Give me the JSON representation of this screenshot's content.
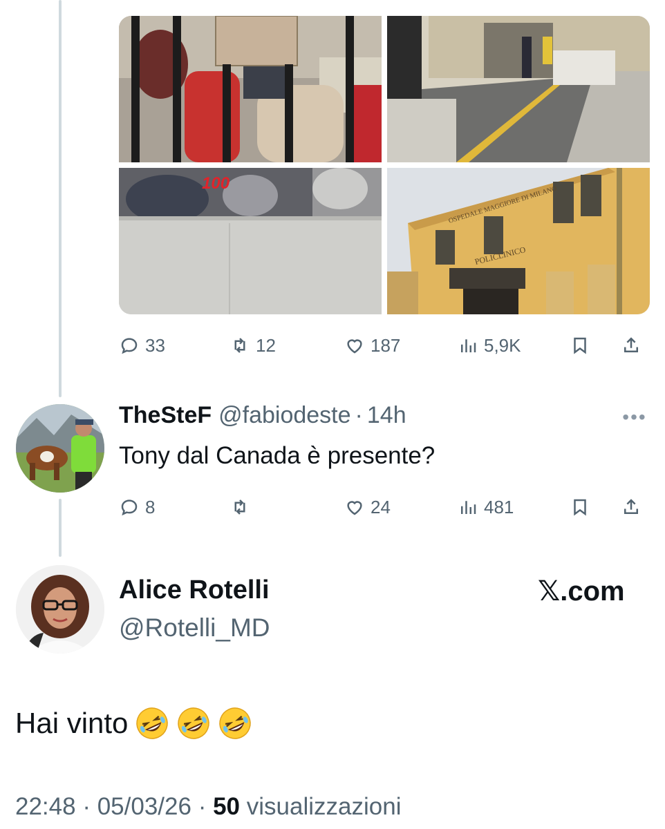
{
  "quoted_post": {
    "stats": {
      "replies": "33",
      "reposts": "12",
      "likes": "187",
      "views": "5,9K"
    },
    "image_text": {
      "hospital_sign": "POLICLINICO",
      "hospital_facade": "OSPEDALE MAGGIORE DI MILANO",
      "sticker": "100"
    }
  },
  "reply": {
    "display_name": "TheSteF",
    "handle": "@fabiodeste",
    "separator": "·",
    "time": "14h",
    "text": "Tony dal Canada è presente?",
    "stats": {
      "replies": "8",
      "reposts": "",
      "likes": "24",
      "views": "481"
    }
  },
  "post": {
    "display_name": "Alice Rotelli",
    "handle": "@Rotelli_MD",
    "brand": "𝕏.com",
    "text": "Hai vinto",
    "emoji": [
      "rolling-on-floor-laughing",
      "rolling-on-floor-laughing",
      "rolling-on-floor-laughing"
    ],
    "time": "22:48",
    "date": "05/03/26",
    "views_count": "50",
    "views_label": "visualizzazioni",
    "separator": "·"
  },
  "colors": {
    "secondary_text": "#536471",
    "thread_line": "#cfd9de",
    "text": "#0f1419"
  }
}
